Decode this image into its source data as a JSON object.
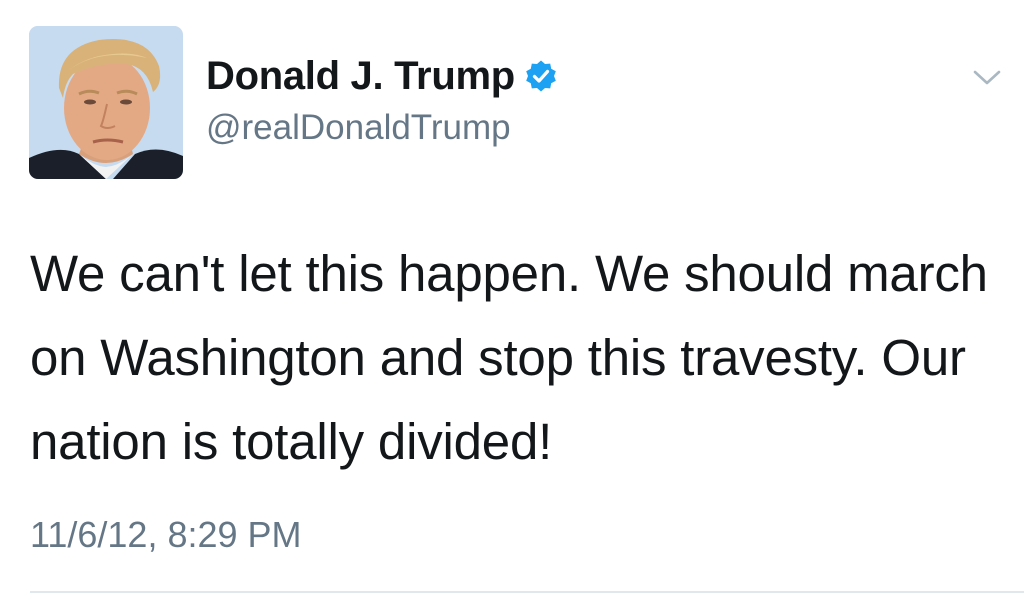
{
  "user": {
    "display_name": "Donald J. Trump",
    "handle": "@realDonaldTrump",
    "verified": true,
    "avatar_icon": "profile-photo"
  },
  "tweet": {
    "text": "We can't let this happen. We should march on Washington and stop this travesty. Our nation is totally divided!",
    "timestamp": "11/6/12, 8:29 PM"
  },
  "icons": {
    "verified": "verified-badge-icon",
    "menu": "chevron-down-icon"
  },
  "colors": {
    "verified_blue": "#1da1f2",
    "secondary_text": "#657786",
    "primary_text": "#14171a",
    "divider": "#e1e8ed"
  }
}
